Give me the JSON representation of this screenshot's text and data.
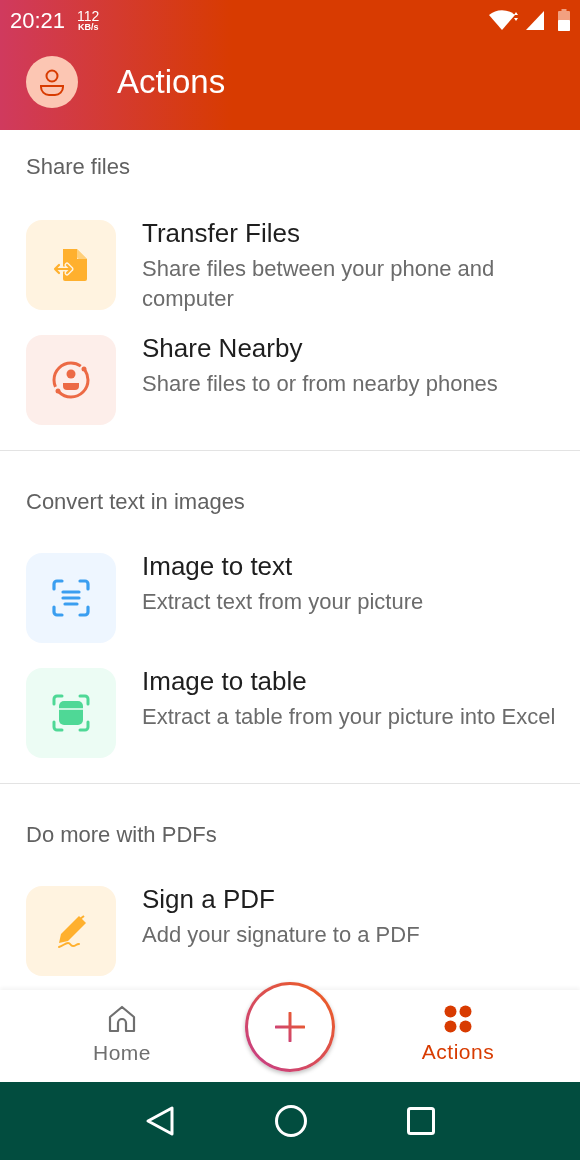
{
  "status_bar": {
    "time": "20:21",
    "speed_value": "112",
    "speed_unit": "KB/s"
  },
  "header": {
    "title": "Actions"
  },
  "sections": [
    {
      "heading": "Share files",
      "items": [
        {
          "kind": "transfer",
          "title": "Transfer Files",
          "subtitle": "Share files between your phone and computer"
        },
        {
          "kind": "nearby",
          "title": "Share Nearby",
          "subtitle": "Share files to or from nearby phones"
        }
      ]
    },
    {
      "heading": "Convert text in images",
      "items": [
        {
          "kind": "image_text",
          "title": "Image to text",
          "subtitle": "Extract text from your picture"
        },
        {
          "kind": "image_table",
          "title": "Image to table",
          "subtitle": "Extract a table from your picture into Excel"
        }
      ]
    },
    {
      "heading": "Do more with PDFs",
      "items": [
        {
          "kind": "sign",
          "title": "Sign a PDF",
          "subtitle": "Add your signature to a PDF"
        }
      ]
    }
  ],
  "bottom_nav": {
    "tabs": [
      {
        "kind": "home",
        "label": "Home",
        "selected": false
      },
      {
        "kind": "actions",
        "label": "Actions",
        "selected": true
      }
    ]
  }
}
